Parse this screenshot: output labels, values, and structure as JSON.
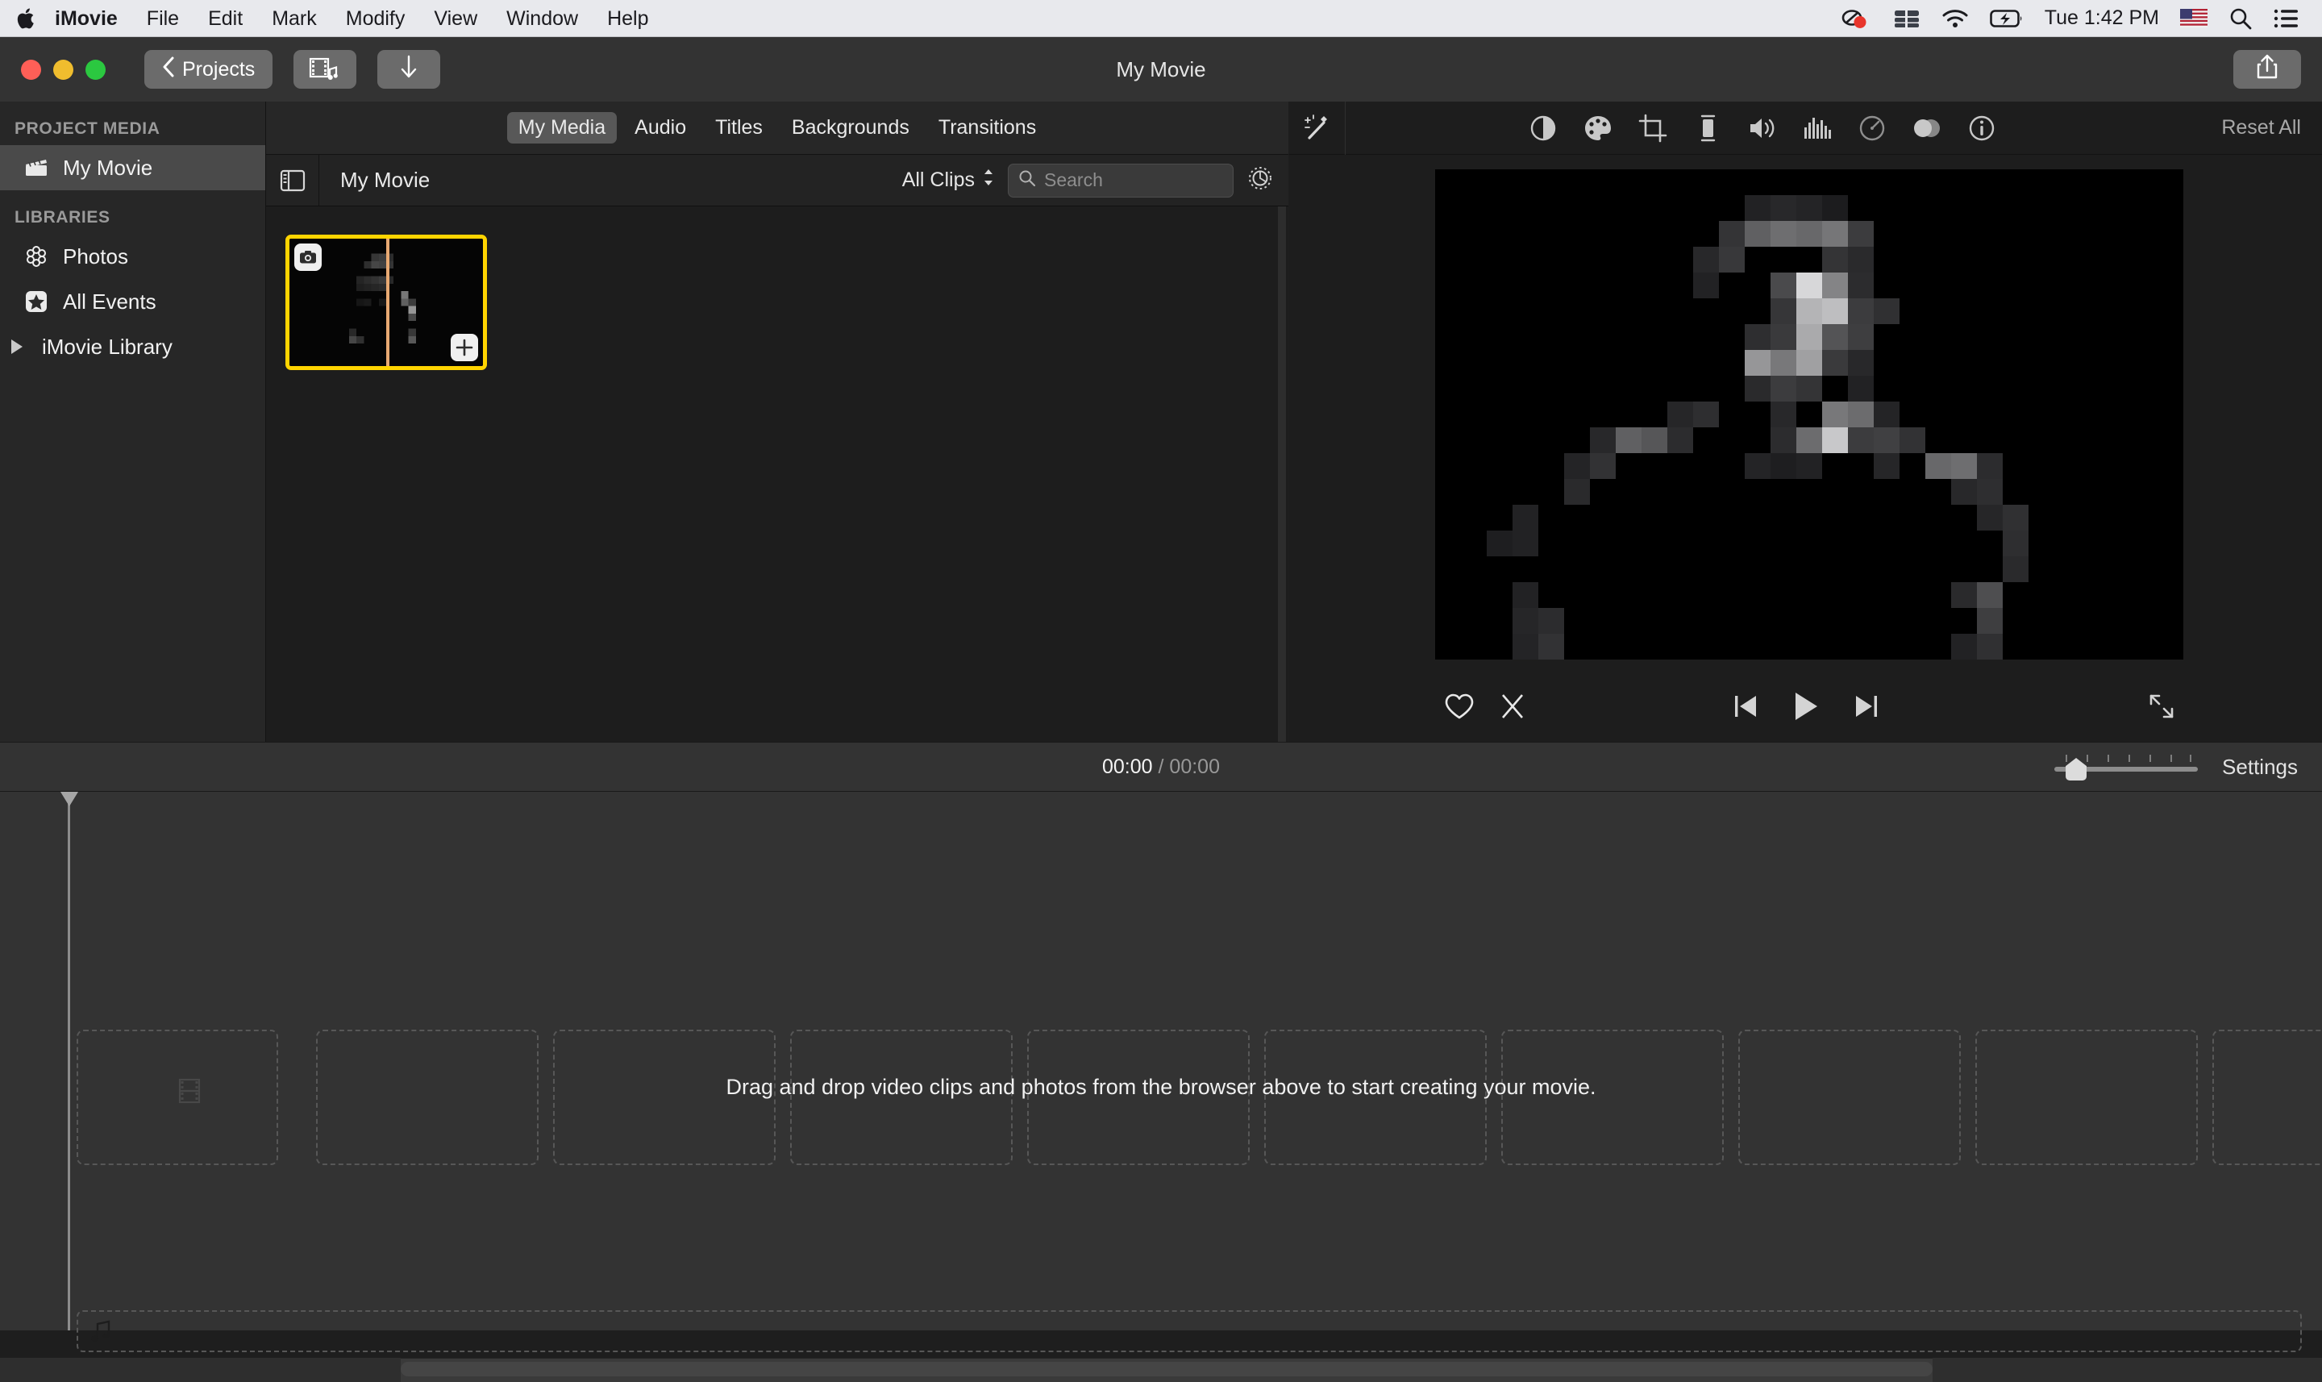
{
  "menubar": {
    "apple_icon": "apple-logo-icon",
    "items": [
      {
        "label": "iMovie",
        "bold": true
      },
      {
        "label": "File"
      },
      {
        "label": "Edit"
      },
      {
        "label": "Mark"
      },
      {
        "label": "Modify"
      },
      {
        "label": "View"
      },
      {
        "label": "Window"
      },
      {
        "label": "Help"
      }
    ],
    "status_icons": [
      "screen-recording-icon",
      "stacks-icon",
      "wifi-icon",
      "battery-charging-icon"
    ],
    "clock": "Tue 1:42 PM",
    "flag": "us-flag-icon",
    "search_icon": "spotlight-search-icon",
    "control_center_icon": "control-center-icon"
  },
  "titlebar": {
    "projects_label": "Projects",
    "window_title": "My Movie",
    "media_button_icon": "film-music-icon",
    "import_button_icon": "download-arrow-icon",
    "share_button_icon": "share-icon"
  },
  "sidebar": {
    "section_project": "PROJECT MEDIA",
    "project_items": [
      {
        "label": "My Movie",
        "icon": "clapperboard-icon",
        "selected": true
      }
    ],
    "section_libraries": "LIBRARIES",
    "library_items": [
      {
        "label": "Photos",
        "icon": "photos-flower-icon",
        "selected": false
      },
      {
        "label": "All Events",
        "icon": "star-icon",
        "selected": false
      },
      {
        "label": "iMovie Library",
        "icon": "disclosure-triangle-icon",
        "selected": false
      }
    ]
  },
  "tabs": [
    {
      "label": "My Media",
      "active": true
    },
    {
      "label": "Audio",
      "active": false
    },
    {
      "label": "Titles",
      "active": false
    },
    {
      "label": "Backgrounds",
      "active": false
    },
    {
      "label": "Transitions",
      "active": false
    }
  ],
  "browser_toolbar": {
    "sidebar_toggle_icon": "sidebar-toggle-icon",
    "title": "My Movie",
    "filter_label": "All Clips",
    "filter_chevron_icon": "updown-chevron-icon",
    "search_icon": "search-icon",
    "search_value": "",
    "search_placeholder": "Search",
    "settings_icon": "gear-icon"
  },
  "browser": {
    "clips": [
      {
        "name": "selected-clip",
        "camera_badge_icon": "camera-icon",
        "add_badge_icon": "plus-icon",
        "selected": true
      }
    ]
  },
  "viewer": {
    "wand_icon": "magic-wand-icon",
    "adjust_icons": [
      "color-balance-icon",
      "color-palette-icon",
      "crop-icon",
      "stabilization-icon",
      "volume-icon",
      "audio-equalizer-icon",
      "speed-gauge-icon",
      "filters-icon",
      "info-icon"
    ],
    "reset_label": "Reset All",
    "favorite_icon": "heart-icon",
    "reject_icon": "reject-x-icon",
    "prev_icon": "skip-previous-icon",
    "play_icon": "play-icon",
    "next_icon": "skip-next-icon",
    "fullscreen_icon": "fullscreen-arrows-icon"
  },
  "statusbar": {
    "current_time": "00:00",
    "separator": "/",
    "total_time": "00:00",
    "zoom_ticks": 7,
    "zoom_thumb_position_pct": 12,
    "settings_label": "Settings"
  },
  "timeline": {
    "empty_message": "Drag and drop video clips and photos from the browser above to start creating your movie.",
    "video_dropzone_count": 12,
    "film_icon": "film-strip-icon",
    "audio_icon": "music-note-icon",
    "playhead_icon": "playhead-triangle-icon"
  },
  "colors": {
    "selection_yellow": "#ffd400",
    "titlebar_gray": "#333333",
    "sidebar_gray": "#272727",
    "browser_bg": "#1d1d1d",
    "menubar_bg": "#e8e9ed",
    "playhead_orange": "#e8a972"
  }
}
